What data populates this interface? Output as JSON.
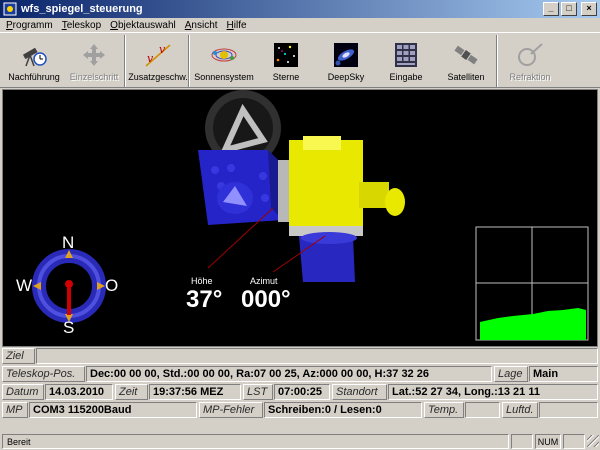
{
  "window": {
    "title": "wfs_spiegel_steuerung"
  },
  "menu": [
    "Programm",
    "Teleskop",
    "Objektauswahl",
    "Ansicht",
    "Hilfe"
  ],
  "toolbar": [
    {
      "label": "Nachführung",
      "icon": "telescope-clock-icon",
      "enabled": true
    },
    {
      "label": "Einzelschritt",
      "icon": "move-arrows-icon",
      "enabled": false
    },
    {
      "label": "Zusatzgeschw.",
      "icon": "vv-speed-icon",
      "enabled": true
    },
    {
      "label": "Sonnensystem",
      "icon": "solar-system-icon",
      "enabled": true
    },
    {
      "label": "Sterne",
      "icon": "stars-icon",
      "enabled": true
    },
    {
      "label": "DeepSky",
      "icon": "galaxy-icon",
      "enabled": true
    },
    {
      "label": "Eingabe",
      "icon": "keypad-icon",
      "enabled": true
    },
    {
      "label": "Satelliten",
      "icon": "satellite-icon",
      "enabled": true
    },
    {
      "label": "Refraktion",
      "icon": "refraction-icon",
      "enabled": false
    }
  ],
  "view": {
    "hoehe_label": "Höhe",
    "hoehe_value": "37°",
    "azimut_label": "Azimut",
    "azimut_value": "000°",
    "compass": {
      "n": "N",
      "s": "S",
      "w": "W",
      "o": "O"
    }
  },
  "status": {
    "ziel_label": "Ziel",
    "ziel_value": "",
    "teleskop_pos_label": "Teleskop-Pos.",
    "teleskop_pos_value": "Dec:00 00 00, Std.:00 00 00, Ra:07 00 25, Az:000 00 00, H:37 32 26",
    "lage_label": "Lage",
    "lage_value": "Main",
    "datum_label": "Datum",
    "datum_value": "14.03.2010",
    "zeit_label": "Zeit",
    "zeit_value": "19:37:56 MEZ",
    "lst_label": "LST",
    "lst_value": "07:00:25",
    "standort_label": "Standort",
    "standort_value": "Lat.:52 27 34, Long.:13 21 11",
    "mp_label": "MP",
    "mp_value": "COM3 115200Baud",
    "mp_fehler_label": "MP-Fehler",
    "mp_fehler_value": "Schreiben:0 / Lesen:0",
    "temp_label": "Temp.",
    "luftd_label": "Luftd."
  },
  "statusbar": {
    "text": "Bereit",
    "num": "NUM"
  },
  "colors": {
    "title_start": "#0a246a",
    "title_end": "#a6caf0",
    "scope_yellow": "#e8e800",
    "mount_blue": "#2020c0",
    "graph_green": "#00ff00"
  }
}
